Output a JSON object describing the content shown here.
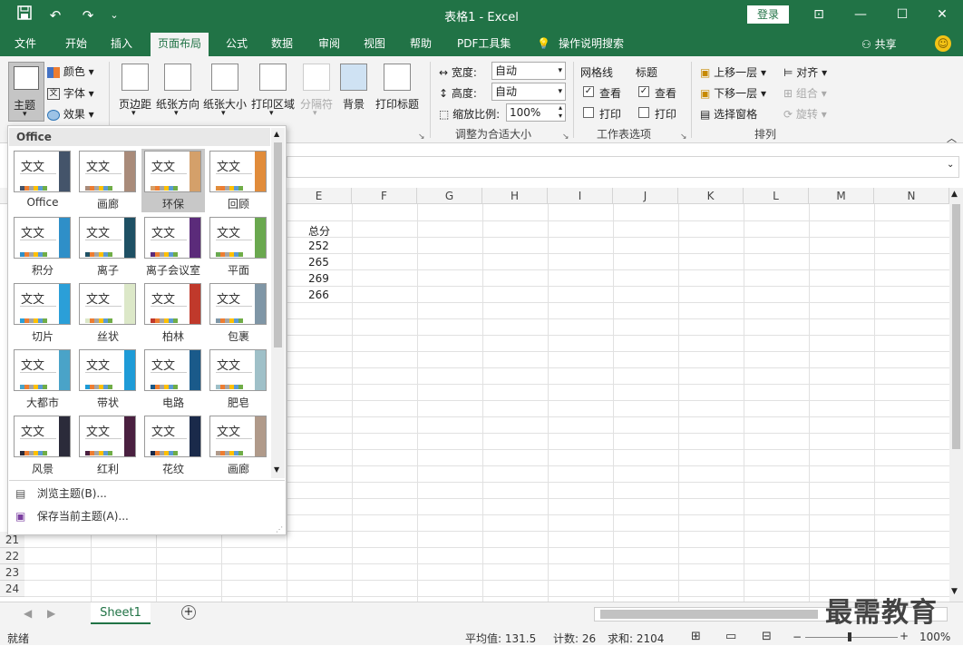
{
  "titlebar": {
    "title": "表格1  -  Excel",
    "login": "登录",
    "save_icon": "save-icon",
    "undo_icon": "undo-icon",
    "redo_icon": "redo-icon"
  },
  "menu": {
    "tabs": [
      "文件",
      "开始",
      "插入",
      "页面布局",
      "公式",
      "数据",
      "审阅",
      "视图",
      "帮助",
      "PDF工具集",
      "操作说明搜索"
    ],
    "active_tab": "页面布局",
    "share": "共享"
  },
  "ribbon": {
    "theme_label": "主题",
    "colors": "颜色",
    "fonts": "字体",
    "effects": "效果",
    "margins": "页边距",
    "orientation": "纸张方向",
    "size": "纸张大小",
    "print_area": "打印区域",
    "breaks": "分隔符",
    "background": "背景",
    "print_titles": "打印标题",
    "width_label": "宽度:",
    "width_value": "自动",
    "height_label": "高度:",
    "height_value": "自动",
    "scale_label": "缩放比例:",
    "scale_value": "100%",
    "fit_group": "调整为合适大小",
    "gridlines": "网格线",
    "headings": "标题",
    "view": "查看",
    "print": "打印",
    "sheet_options_group": "工作表选项",
    "bring_forward": "上移一层",
    "send_backward": "下移一层",
    "selection_pane": "选择窗格",
    "align": "对齐",
    "group": "组合",
    "rotate": "旋转",
    "arrange_group": "排列"
  },
  "sheet": {
    "columns": [
      "E",
      "F",
      "G",
      "H",
      "I",
      "J",
      "K",
      "L",
      "M",
      "N"
    ],
    "rows": [
      "21",
      "22",
      "23",
      "24"
    ],
    "header_cell": "总分",
    "values": [
      "252",
      "265",
      "269",
      "266"
    ],
    "tab_name": "Sheet1"
  },
  "themes_dropdown": {
    "section": "Office",
    "themes": [
      {
        "name": "Office",
        "stripe": "#44546a"
      },
      {
        "name": "画廊",
        "stripe": "#a98b7a"
      },
      {
        "name": "环保",
        "stripe": "#d4a06a"
      },
      {
        "name": "回顾",
        "stripe": "#e18c3b"
      },
      {
        "name": "积分",
        "stripe": "#2f8fc8"
      },
      {
        "name": "离子",
        "stripe": "#1e5064"
      },
      {
        "name": "离子会议室",
        "stripe": "#5b2b7a"
      },
      {
        "name": "平面",
        "stripe": "#6aa84f"
      },
      {
        "name": "切片",
        "stripe": "#2b9fd8"
      },
      {
        "name": "丝状",
        "stripe": "#dce8c8"
      },
      {
        "name": "柏林",
        "stripe": "#c0392b"
      },
      {
        "name": "包裹",
        "stripe": "#7f96a6"
      },
      {
        "name": "大都市",
        "stripe": "#4aa3c8"
      },
      {
        "name": "带状",
        "stripe": "#1e9bd7"
      },
      {
        "name": "电路",
        "stripe": "#1a5a8a"
      },
      {
        "name": "肥皂",
        "stripe": "#9fc0c8"
      },
      {
        "name": "风景",
        "stripe": "#2b2b3a"
      },
      {
        "name": "红利",
        "stripe": "#4a2040"
      },
      {
        "name": "花纹",
        "stripe": "#1a2a4a"
      },
      {
        "name": "画廊",
        "stripe": "#b09a8a"
      }
    ],
    "browse": "浏览主题(B)...",
    "save": "保存当前主题(A)...",
    "sample_text": "文文"
  },
  "status": {
    "ready": "就绪",
    "average": "平均值: 131.5",
    "count": "计数: 26",
    "sum": "求和: 2104",
    "zoom": "100%"
  },
  "watermark": "最需教育"
}
